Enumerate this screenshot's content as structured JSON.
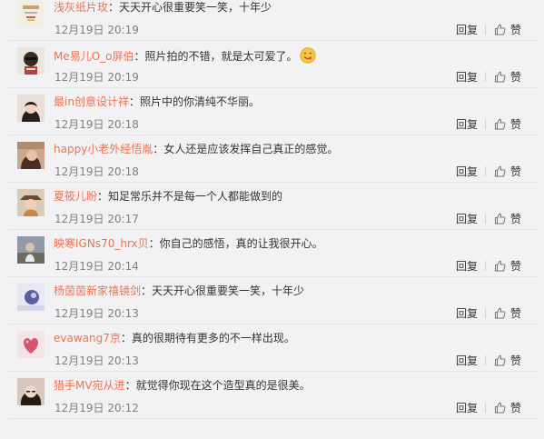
{
  "comments": [
    {
      "user": "浅灰纸片玫",
      "content": "天天开心很重要笑一笑，十年少",
      "time": "12月19日 20:19",
      "reply": "回复",
      "like": "赞",
      "emoji": ""
    },
    {
      "user": "Me易儿O_o屏伯",
      "content": "照片拍的不错，就是太可爱了。",
      "time": "12月19日 20:19",
      "reply": "回复",
      "like": "赞",
      "emoji": "yum-face-emoji"
    },
    {
      "user": "最in创意设计祥",
      "content": "照片中的你清纯不华丽。",
      "time": "12月19日 20:18",
      "reply": "回复",
      "like": "赞",
      "emoji": ""
    },
    {
      "user": "happy小老外经悟胤",
      "content": "女人还是应该发挥自己真正的感觉。",
      "time": "12月19日 20:18",
      "reply": "回复",
      "like": "赞",
      "emoji": ""
    },
    {
      "user": "夏筱儿盼",
      "content": "知足常乐并不是每一个人都能做到的",
      "time": "12月19日 20:17",
      "reply": "回复",
      "like": "赞",
      "emoji": ""
    },
    {
      "user": "映寒IGNs70_hrx贝",
      "content": "你自己的感悟，真的让我很开心。",
      "time": "12月19日 20:14",
      "reply": "回复",
      "like": "赞",
      "emoji": ""
    },
    {
      "user": "杨茵茵新家禧镜剑",
      "content": "天天开心很重要笑一笑，十年少",
      "time": "12月19日 20:13",
      "reply": "回复",
      "like": "赞",
      "emoji": ""
    },
    {
      "user": "evawang7京",
      "content": "真的很期待有更多的不一样出现。",
      "time": "12月19日 20:13",
      "reply": "回复",
      "like": "赞",
      "emoji": ""
    },
    {
      "user": "猎手MV宛从进",
      "content": "就觉得你现在这个造型真的是很美。",
      "time": "12月19日 20:12",
      "reply": "回复",
      "like": "赞",
      "emoji": ""
    }
  ],
  "colors": {
    "username": "#eb7350",
    "text": "#333333",
    "time": "#808080",
    "background": "#f2f2f5"
  }
}
